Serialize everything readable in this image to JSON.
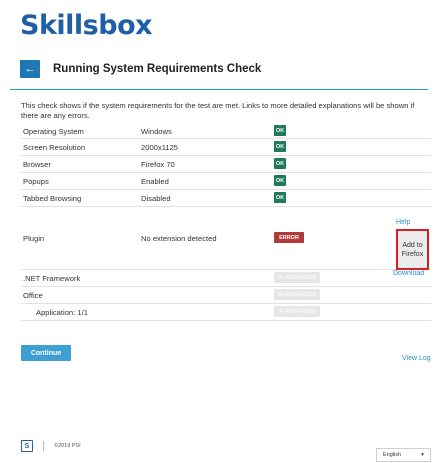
{
  "brand": {
    "logo_text": "Skillsbox"
  },
  "header": {
    "back_icon": "arrow-left-icon",
    "back_glyph": "←",
    "title": "Running System Requirements Check"
  },
  "intro": "This check shows if the system requirements for the test are met. Links to more detailed explanations will be shown if there are any errors.",
  "checks": [
    {
      "label": "Operating System",
      "value": "Windows",
      "status": "OK",
      "status_kind": "ok"
    },
    {
      "label": "Screen Resolution",
      "value": "2000x1125",
      "status": "OK",
      "status_kind": "ok"
    },
    {
      "label": "Browser",
      "value": "Firefox 70",
      "status": "OK",
      "status_kind": "ok"
    },
    {
      "label": "Popups",
      "value": "Enabled",
      "status": "OK",
      "status_kind": "ok"
    },
    {
      "label": "Tabbed Browsing",
      "value": "Disabled",
      "status": "OK",
      "status_kind": "ok"
    },
    {
      "label": "Plugin",
      "value": "No extension detected",
      "status": "ERROR",
      "status_kind": "error"
    },
    {
      "label": ".NET Framework",
      "value": "",
      "status": "IN PROGRESS",
      "status_kind": "progress"
    },
    {
      "label": "Office",
      "value": "",
      "status": "IN PROGRESS",
      "status_kind": "progress"
    },
    {
      "label": "Application: 1/1",
      "value": "",
      "status": "IN PROGRESS",
      "status_kind": "progress"
    }
  ],
  "plugin_actions": {
    "help": "Help",
    "add_button": "Add to Firefox",
    "download": "Download"
  },
  "actions": {
    "continue": "Continue",
    "view_log": "View Log"
  },
  "footer": {
    "logo_glyph": "S",
    "copyright": "©2019 PSI",
    "language": "English",
    "chevron_icon": "chevron-down-icon"
  },
  "colors": {
    "brand_blue": "#1f5fa6",
    "ok_green": "#1f7a5c",
    "error_red": "#b33a3a",
    "link_blue": "#2d8ec6",
    "highlight_red": "#d62027"
  }
}
